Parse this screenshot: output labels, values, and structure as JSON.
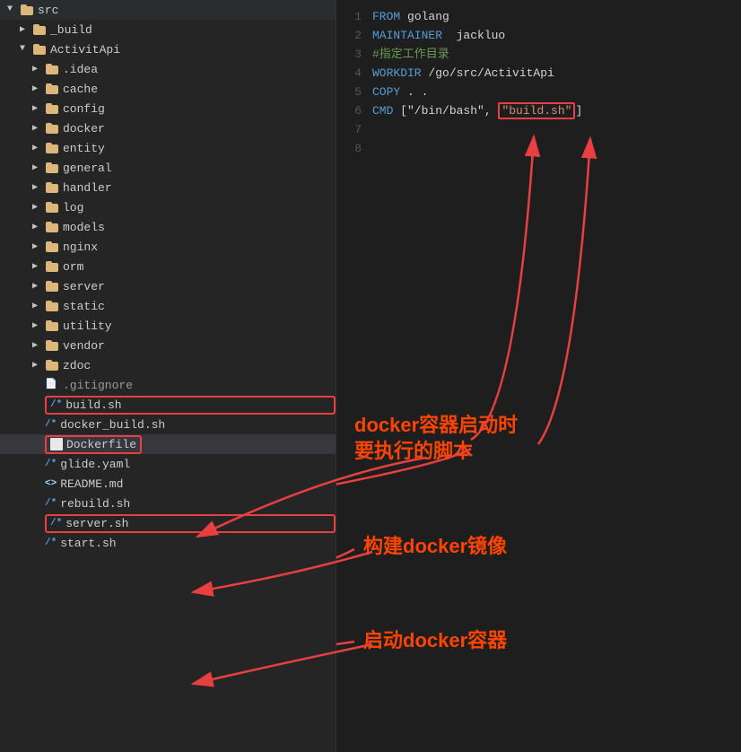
{
  "filetree": {
    "items": [
      {
        "id": "src",
        "label": "src",
        "type": "folder",
        "indent": 1,
        "arrow": "open"
      },
      {
        "id": "_build",
        "label": "_build",
        "type": "folder",
        "indent": 2,
        "arrow": "closed"
      },
      {
        "id": "ActivitApi",
        "label": "ActivitApi",
        "type": "folder",
        "indent": 2,
        "arrow": "open"
      },
      {
        "id": ".idea",
        "label": ".idea",
        "type": "folder",
        "indent": 3,
        "arrow": "closed"
      },
      {
        "id": "cache",
        "label": "cache",
        "type": "folder",
        "indent": 3,
        "arrow": "closed"
      },
      {
        "id": "config",
        "label": "config",
        "type": "folder",
        "indent": 3,
        "arrow": "closed"
      },
      {
        "id": "docker",
        "label": "docker",
        "type": "folder",
        "indent": 3,
        "arrow": "closed"
      },
      {
        "id": "entity",
        "label": "entity",
        "type": "folder",
        "indent": 3,
        "arrow": "closed"
      },
      {
        "id": "general",
        "label": "general",
        "type": "folder",
        "indent": 3,
        "arrow": "closed"
      },
      {
        "id": "handler",
        "label": "handler",
        "type": "folder",
        "indent": 3,
        "arrow": "closed"
      },
      {
        "id": "log",
        "label": "log",
        "type": "folder",
        "indent": 3,
        "arrow": "closed"
      },
      {
        "id": "models",
        "label": "models",
        "type": "folder",
        "indent": 3,
        "arrow": "closed"
      },
      {
        "id": "nginx",
        "label": "nginx",
        "type": "folder",
        "indent": 3,
        "arrow": "closed"
      },
      {
        "id": "orm",
        "label": "orm",
        "type": "folder",
        "indent": 3,
        "arrow": "closed"
      },
      {
        "id": "server",
        "label": "server",
        "type": "folder",
        "indent": 3,
        "arrow": "closed"
      },
      {
        "id": "static",
        "label": "static",
        "type": "folder",
        "indent": 3,
        "arrow": "closed"
      },
      {
        "id": "utility",
        "label": "utility",
        "type": "folder",
        "indent": 3,
        "arrow": "closed"
      },
      {
        "id": "vendor",
        "label": "vendor",
        "type": "folder",
        "indent": 3,
        "arrow": "closed"
      },
      {
        "id": "zdoc",
        "label": "zdoc",
        "type": "folder",
        "indent": 3,
        "arrow": "closed"
      },
      {
        "id": ".gitignore",
        "label": ".gitignore",
        "type": "file-plain",
        "indent": 3
      },
      {
        "id": "build.sh",
        "label": "build.sh",
        "type": "file-sh",
        "indent": 3,
        "highlighted": true
      },
      {
        "id": "docker_build.sh",
        "label": "docker_build.sh",
        "type": "file-sh",
        "indent": 3
      },
      {
        "id": "Dockerfile",
        "label": "Dockerfile",
        "type": "file-plain",
        "indent": 3,
        "selected": true
      },
      {
        "id": "glide.yaml",
        "label": "glide.yaml",
        "type": "file-sh",
        "indent": 3
      },
      {
        "id": "README.md",
        "label": "README.md",
        "type": "file-angle",
        "indent": 3
      },
      {
        "id": "rebuild.sh",
        "label": "rebuild.sh",
        "type": "file-sh",
        "indent": 3
      },
      {
        "id": "server.sh",
        "label": "server.sh",
        "type": "file-sh",
        "indent": 3,
        "highlighted": true
      },
      {
        "id": "start.sh",
        "label": "start.sh",
        "type": "file-sh",
        "indent": 3
      }
    ]
  },
  "code": {
    "lines": [
      {
        "num": 1,
        "content": "FROM golang",
        "tokens": [
          {
            "text": "FROM ",
            "cls": "kw-blue"
          },
          {
            "text": "golang",
            "cls": ""
          }
        ]
      },
      {
        "num": 2,
        "content": "MAINTAINER  jackluo",
        "tokens": [
          {
            "text": "MAINTAINER",
            "cls": "kw-blue"
          },
          {
            "text": "  jackluo",
            "cls": ""
          }
        ]
      },
      {
        "num": 3,
        "content": "#指定工作目录",
        "tokens": [
          {
            "text": "#指定工作目录",
            "cls": "kw-comment"
          }
        ]
      },
      {
        "num": 4,
        "content": "WORKDIR /go/src/ActivitApi",
        "tokens": [
          {
            "text": "WORKDIR",
            "cls": "kw-blue"
          },
          {
            "text": " /go/src/ActivitApi",
            "cls": ""
          }
        ]
      },
      {
        "num": 5,
        "content": "COPY . .",
        "tokens": [
          {
            "text": "COPY",
            "cls": "kw-blue"
          },
          {
            "text": " . .",
            "cls": ""
          }
        ]
      },
      {
        "num": 6,
        "content": "",
        "tokens": []
      },
      {
        "num": 7,
        "content": "CMD [\"/bin/bash\", \"build.sh\"]",
        "tokens": [
          {
            "text": "CMD",
            "cls": "kw-blue"
          },
          {
            "text": " [\"/bin/bash\",",
            "cls": ""
          },
          {
            "text": " \"build.sh\"",
            "cls": "kw-string",
            "highlight": true
          },
          {
            "text": "]",
            "cls": ""
          }
        ]
      },
      {
        "num": 8,
        "content": "",
        "tokens": []
      }
    ]
  },
  "annotations": {
    "docker_startup": "docker容器启动时\n要执行的脚本",
    "build_docker": "构建docker镜像",
    "start_docker": "启动docker容器"
  }
}
